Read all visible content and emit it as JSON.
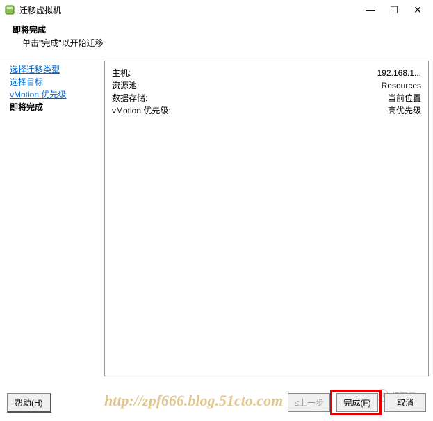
{
  "titlebar": {
    "title": "迁移虚拟机"
  },
  "header": {
    "title": "即将完成",
    "subtitle": "单击\"完成\"以开始迁移"
  },
  "sidebar": {
    "links": [
      "选择迁移类型",
      "选择目标",
      "vMotion 优先级"
    ],
    "current": "即将完成"
  },
  "summary": {
    "rows": [
      {
        "label": "主机:",
        "value": "192.168.1..."
      },
      {
        "label": "资源池:",
        "value": "Resources"
      },
      {
        "label": "数据存储:",
        "value": "当前位置"
      },
      {
        "label": "vMotion 优先级:",
        "value": "高优先级"
      }
    ]
  },
  "footer": {
    "help": "帮助(H)",
    "back": "≤上一步",
    "finish": "完成(F)",
    "cancel": "取消"
  },
  "watermark": "http://zpf666.blog.51cto.com",
  "brand": "亿速云"
}
